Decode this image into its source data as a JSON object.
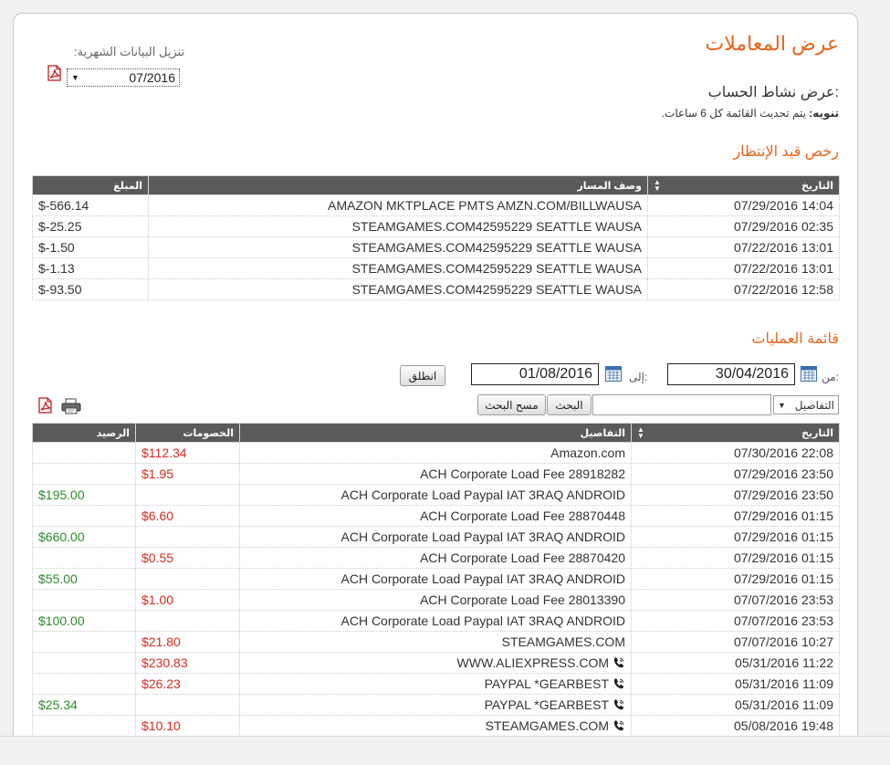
{
  "header": {
    "title": "عرض المعاملات",
    "subtitle": "عرض نشاط الحساب:",
    "notice_label": "تنويه:",
    "notice_text": "يتم تحديث القائمة كل 6 ساعات."
  },
  "download": {
    "label": "تنزيل البيانات الشهرية:",
    "selected_month": "07/2016"
  },
  "pending": {
    "title": "رخص قيد الإنتظار",
    "columns": {
      "date": "التاريخ",
      "description": "وصف المسار",
      "amount": "المبلغ"
    },
    "rows": [
      {
        "date": "14:04 07/29/2016",
        "description": "AMAZON MKTPLACE PMTS AMZN.COM/BILLWAUSA",
        "amount": "566.14-$"
      },
      {
        "date": "02:35 07/29/2016",
        "description": "STEAMGAMES.COM42595229 SEATTLE WAUSA",
        "amount": "25.25-$"
      },
      {
        "date": "13:01 07/22/2016",
        "description": "STEAMGAMES.COM42595229 SEATTLE WAUSA",
        "amount": "1.50-$"
      },
      {
        "date": "13:01 07/22/2016",
        "description": "STEAMGAMES.COM42595229 SEATTLE WAUSA",
        "amount": "1.13-$"
      },
      {
        "date": "12:58 07/22/2016",
        "description": "STEAMGAMES.COM42595229 SEATTLE WAUSA",
        "amount": "93.50-$"
      }
    ]
  },
  "operations": {
    "title": "قائمة العمليات",
    "from_label": "من:",
    "from_value": "30/04/2016",
    "to_label": "إلى:",
    "to_value": "01/08/2016",
    "go_button": "انطلق",
    "filter_select": "التفاصيل",
    "search_value": "",
    "search_button": "البحث",
    "clear_button": "مسح البحث",
    "columns": {
      "date": "التاريخ",
      "details": "التفاصيل",
      "debits": "الخصومات",
      "balance": "الرصيد"
    },
    "rows": [
      {
        "date": "22:08 07/30/2016",
        "details": "Amazon.com",
        "debit": "$112.34",
        "balance": "",
        "phone": false
      },
      {
        "date": "23:50 07/29/2016",
        "details": "ACH Corporate Load Fee 28918282",
        "debit": "$1.95",
        "balance": "",
        "phone": false
      },
      {
        "date": "23:50 07/29/2016",
        "details": "ACH Corporate Load Paypal IAT 3RAQ ANDROID",
        "debit": "",
        "balance": "$195.00",
        "phone": false
      },
      {
        "date": "01:15 07/29/2016",
        "details": "ACH Corporate Load Fee 28870448",
        "debit": "$6.60",
        "balance": "",
        "phone": false
      },
      {
        "date": "01:15 07/29/2016",
        "details": "ACH Corporate Load Paypal IAT 3RAQ ANDROID",
        "debit": "",
        "balance": "$660.00",
        "phone": false
      },
      {
        "date": "01:15 07/29/2016",
        "details": "ACH Corporate Load Fee 28870420",
        "debit": "$0.55",
        "balance": "",
        "phone": false
      },
      {
        "date": "01:15 07/29/2016",
        "details": "ACH Corporate Load Paypal IAT 3RAQ ANDROID",
        "debit": "",
        "balance": "$55.00",
        "phone": false
      },
      {
        "date": "23:53 07/07/2016",
        "details": "ACH Corporate Load Fee 28013390",
        "debit": "$1.00",
        "balance": "",
        "phone": false
      },
      {
        "date": "23:53 07/07/2016",
        "details": "ACH Corporate Load Paypal IAT 3RAQ ANDROID",
        "debit": "",
        "balance": "$100.00",
        "phone": false
      },
      {
        "date": "10:27 07/07/2016",
        "details": "STEAMGAMES.COM",
        "debit": "$21.80",
        "balance": "",
        "phone": false
      },
      {
        "date": "11:22 05/31/2016",
        "details": "WWW.ALIEXPRESS.COM",
        "debit": "$230.83",
        "balance": "",
        "phone": true
      },
      {
        "date": "11:09 05/31/2016",
        "details": "PAYPAL *GEARBEST",
        "debit": "$26.23",
        "balance": "",
        "phone": true
      },
      {
        "date": "11:09 05/31/2016",
        "details": "PAYPAL *GEARBEST",
        "debit": "",
        "balance": "$25.34",
        "phone": true
      },
      {
        "date": "19:48 05/08/2016",
        "details": "STEAMGAMES.COM",
        "debit": "$10.10",
        "balance": "",
        "phone": true
      }
    ]
  },
  "colors": {
    "accent": "#e8641c",
    "header_bg": "#5a5a5a",
    "debit": "#d52b1e",
    "credit": "#2e8b2e",
    "calendar": "#3a6fb0"
  },
  "icons": [
    "pdf-icon",
    "calendar-icon",
    "print-icon",
    "sort-icon",
    "phone-icon",
    "chevron-down-icon"
  ]
}
